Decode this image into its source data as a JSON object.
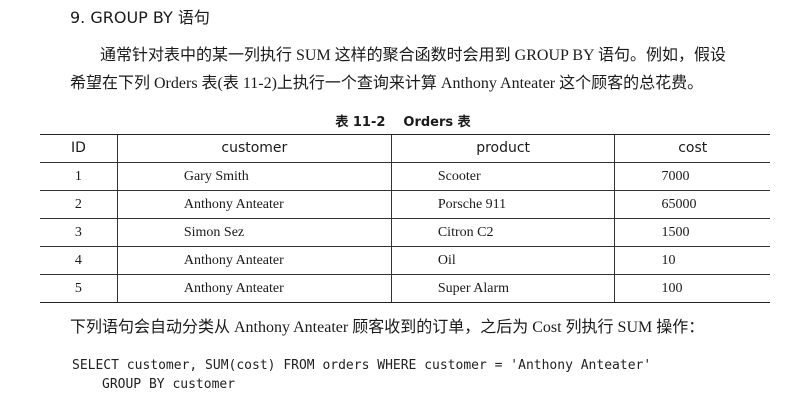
{
  "section": {
    "heading": "9. GROUP BY 语句"
  },
  "intro": {
    "line1": "通常针对表中的某一列执行 SUM 这样的聚合函数时会用到 GROUP BY 语句。例如，假设",
    "line2": "希望在下列 Orders 表(表 11-2)上执行一个查询来计算 Anthony Anteater 这个顾客的总花费。"
  },
  "table": {
    "caption_number": "表 11-2",
    "caption_title": "Orders 表",
    "headers": [
      "ID",
      "customer",
      "product",
      "cost"
    ],
    "rows": [
      [
        "1",
        "Gary Smith",
        "Scooter",
        "7000"
      ],
      [
        "2",
        "Anthony Anteater",
        "Porsche 911",
        "65000"
      ],
      [
        "3",
        "Simon Sez",
        "Citron C2",
        "1500"
      ],
      [
        "4",
        "Anthony Anteater",
        "Oil",
        "10"
      ],
      [
        "5",
        "Anthony Anteater",
        "Super Alarm",
        "100"
      ]
    ]
  },
  "after_text": "下列语句会自动分类从 Anthony Anteater 顾客收到的订单，之后为 Cost 列执行 SUM 操作：",
  "code": {
    "line1": "SELECT customer, SUM(cost) FROM orders WHERE customer = 'Anthony Anteater'",
    "line2": "GROUP BY customer"
  }
}
